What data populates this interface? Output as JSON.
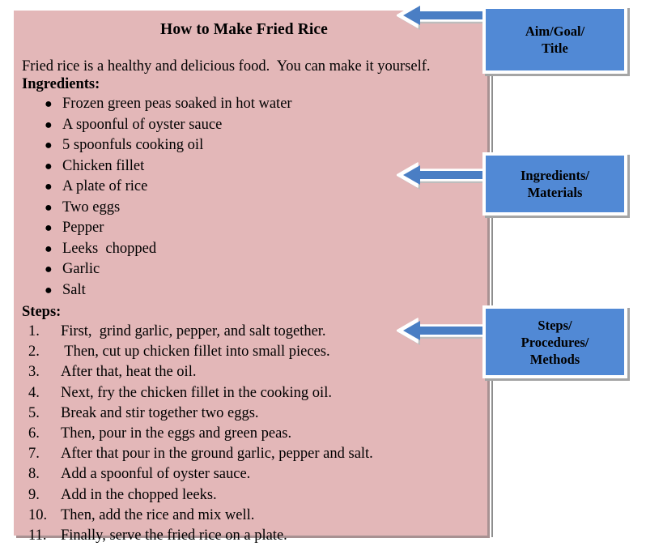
{
  "document": {
    "title": "How to Make Fried Rice",
    "intro": "Fried rice is a healthy and delicious food.  You can make it yourself.",
    "ingredients_heading": "Ingredients:",
    "ingredients": [
      "Frozen green peas soaked in hot water",
      "A spoonful of oyster sauce",
      "5 spoonfuls cooking oil",
      "Chicken fillet",
      "A plate of rice",
      "Two eggs",
      "Pepper",
      "Leeks  chopped",
      "Garlic",
      "Salt"
    ],
    "bullet_glyph": "●",
    "steps_heading": "Steps:",
    "steps": [
      {
        "number": "1.",
        "text": "First,  grind garlic, pepper, and salt together."
      },
      {
        "number": "2.",
        "text": " Then, cut up chicken fillet into small pieces."
      },
      {
        "number": "3.",
        "text": "After that, heat the oil."
      },
      {
        "number": "4.",
        "text": "Next, fry the chicken fillet in the cooking oil."
      },
      {
        "number": "5.",
        "text": "Break and stir together two eggs."
      },
      {
        "number": "6.",
        "text": "Then, pour in the eggs and green peas."
      },
      {
        "number": "7.",
        "text": "After that pour in the ground garlic, pepper and salt."
      },
      {
        "number": "8.",
        "text": "Add a spoonful of oyster sauce."
      },
      {
        "number": "9.",
        "text": "Add in the chopped leeks."
      },
      {
        "number": "10.",
        "text": "Then, add the rice and mix well."
      },
      {
        "number": "11.",
        "text": "Finally, serve the fried rice on a plate."
      }
    ]
  },
  "annotations": [
    {
      "id": "aim",
      "lines": [
        "Aim/Goal/",
        "Title"
      ],
      "arrow_direction": "left"
    },
    {
      "id": "ingredients",
      "lines": [
        "Ingredients/",
        "Materials"
      ],
      "arrow_direction": "left"
    },
    {
      "id": "steps",
      "lines": [
        "Steps/",
        "Procedures/",
        "Methods"
      ],
      "arrow_direction": "left"
    }
  ],
  "colors": {
    "text_block_background": "#e3b7b8",
    "label_box_fill": "#5189d5",
    "label_box_border": "#ffffff",
    "arrow_fill": "#4a7ec4",
    "arrow_outline": "#ffffff",
    "shadow": "#a5a5a5",
    "connector_line": "#8e8e8e",
    "text": "#000000"
  }
}
